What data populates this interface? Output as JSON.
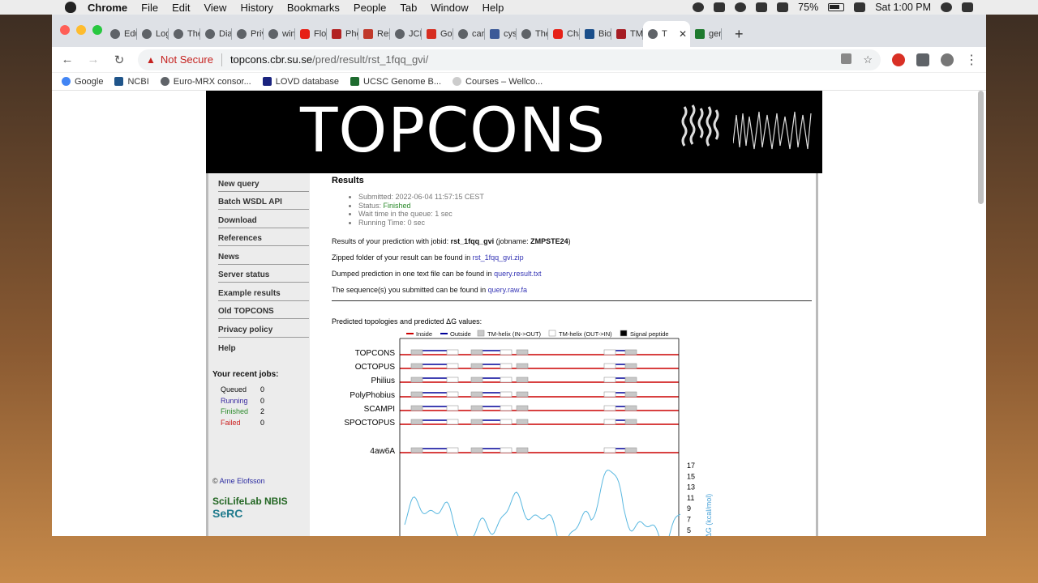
{
  "menubar": {
    "app": "Chrome",
    "items": [
      "File",
      "Edit",
      "View",
      "History",
      "Bookmarks",
      "People",
      "Tab",
      "Window",
      "Help"
    ],
    "battery": "75%",
    "clock": "Sat 1:00 PM"
  },
  "tabs": [
    {
      "label": "Educ"
    },
    {
      "label": "Logi"
    },
    {
      "label": "The"
    },
    {
      "label": "Diag"
    },
    {
      "label": "Priva"
    },
    {
      "label": "wint"
    },
    {
      "label": "Flow"
    },
    {
      "label": "Phe"
    },
    {
      "label": "Rese"
    },
    {
      "label": "JCR"
    },
    {
      "label": "Gove"
    },
    {
      "label": "care"
    },
    {
      "label": "cyst"
    },
    {
      "label": "The"
    },
    {
      "label": "Cha"
    },
    {
      "label": "Biolo"
    },
    {
      "label": "TMH"
    },
    {
      "label": "T"
    },
    {
      "label": "genc"
    }
  ],
  "toolbar": {
    "security": "Not Secure",
    "url_host": "topcons.cbr.su.se",
    "url_path": "/pred/result/rst_1fqq_gvi/"
  },
  "bookmarks": [
    "Google",
    "NCBI",
    "Euro-MRX consor...",
    "LOVD database",
    "UCSC Genome B...",
    "Courses – Wellco..."
  ],
  "banner": {
    "title": "TOPCONS"
  },
  "sidebar": {
    "items": [
      "New query",
      "Batch WSDL API",
      "Download",
      "References",
      "News",
      "Server status",
      "Example results",
      "Old TOPCONS",
      "Privacy policy",
      "Help"
    ],
    "recent_title": "Your recent jobs:",
    "jobs": [
      {
        "label": "Queued",
        "count": "0",
        "color": "#111111"
      },
      {
        "label": "Running",
        "count": "0",
        "color": "#3a2aa0"
      },
      {
        "label": "Finished",
        "count": "2",
        "color": "#2a8a2a"
      },
      {
        "label": "Failed",
        "count": "0",
        "color": "#cc2222"
      }
    ],
    "copyright_symbol": "©",
    "copyright_name": "Arne Elofsson",
    "logo1": "SciLifeLab NBIS",
    "logo2": "SeRC"
  },
  "results": {
    "heading": "Results",
    "submitted": "Submitted: 2022-06-04 11:57:15 CEST",
    "status_label": "Status: ",
    "status_value": "Finished",
    "wait": "Wait time in the queue: 1 sec",
    "running": "Running Time: 0 sec",
    "jobid_prefix": "Results of your prediction with jobid: ",
    "jobid": "rst_1fqq_gvi",
    "jobname_prefix": " (jobname: ",
    "jobname": "ZMPSTE24",
    "jobname_suffix": ")",
    "zip_text": "Zipped folder of your result can be found in ",
    "zip_link": "rst_1fqq_gvi.zip",
    "dump_text": "Dumped prediction in one text file can be found in ",
    "dump_link": "query.result.txt",
    "seq_text": "The sequence(s) you submitted can be found in ",
    "seq_link": "query.raw.fa",
    "predicted_title": "Predicted topologies and predicted ΔG values:"
  },
  "legend": [
    "Inside",
    "Outside",
    "TM-helix (IN->OUT)",
    "TM-helix (OUT->IN)",
    "Signal peptide"
  ],
  "methods": [
    "TOPCONS",
    "OCTOPUS",
    "Philius",
    "PolyPhobius",
    "SCAMPI",
    "SPOCTOPUS",
    "4aw6A"
  ],
  "dg_axis": {
    "label": "ΔG (kcal/mol)",
    "ticks": [
      "17",
      "15",
      "13",
      "11",
      "9",
      "7",
      "5"
    ]
  }
}
